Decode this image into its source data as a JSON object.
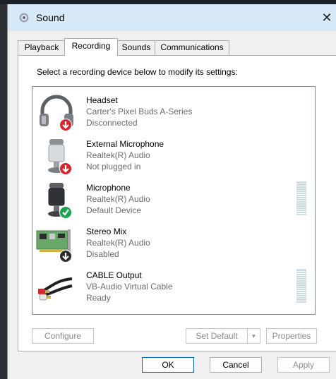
{
  "window": {
    "title": "Sound",
    "close_glyph": "✕"
  },
  "tabs": [
    {
      "label": "Playback",
      "active": false
    },
    {
      "label": "Recording",
      "active": true
    },
    {
      "label": "Sounds",
      "active": false
    },
    {
      "label": "Communications",
      "active": false
    }
  ],
  "panel": {
    "caption": "Select a recording device below to modify its settings:"
  },
  "devices": [
    {
      "name": "Headset",
      "sub": "Carter's Pixel Buds A-Series",
      "status": "Disconnected",
      "icon": "headset-icon",
      "badge": "red-down-arrow"
    },
    {
      "name": "External Microphone",
      "sub": "Realtek(R) Audio",
      "status": "Not plugged in",
      "icon": "external-microphone-icon",
      "badge": "red-down-arrow"
    },
    {
      "name": "Microphone",
      "sub": "Realtek(R) Audio",
      "status": "Default Device",
      "icon": "microphone-icon",
      "badge": "green-check"
    },
    {
      "name": "Stereo Mix",
      "sub": "Realtek(R) Audio",
      "status": "Disabled",
      "icon": "sound-card-icon",
      "badge": "black-down-arrow"
    },
    {
      "name": "CABLE Output",
      "sub": "VB-Audio Virtual Cable",
      "status": "Ready",
      "icon": "rca-cable-icon",
      "badge": "none"
    }
  ],
  "buttons": {
    "configure": "Configure",
    "set_default": "Set Default",
    "set_default_arrow": "▾",
    "properties": "Properties",
    "ok": "OK",
    "cancel": "Cancel",
    "apply": "Apply"
  },
  "colors": {
    "titlebar": "#d7e9f6",
    "badge_red": "#d9252a",
    "badge_green": "#16a34a",
    "primary_border": "#0067c0"
  }
}
